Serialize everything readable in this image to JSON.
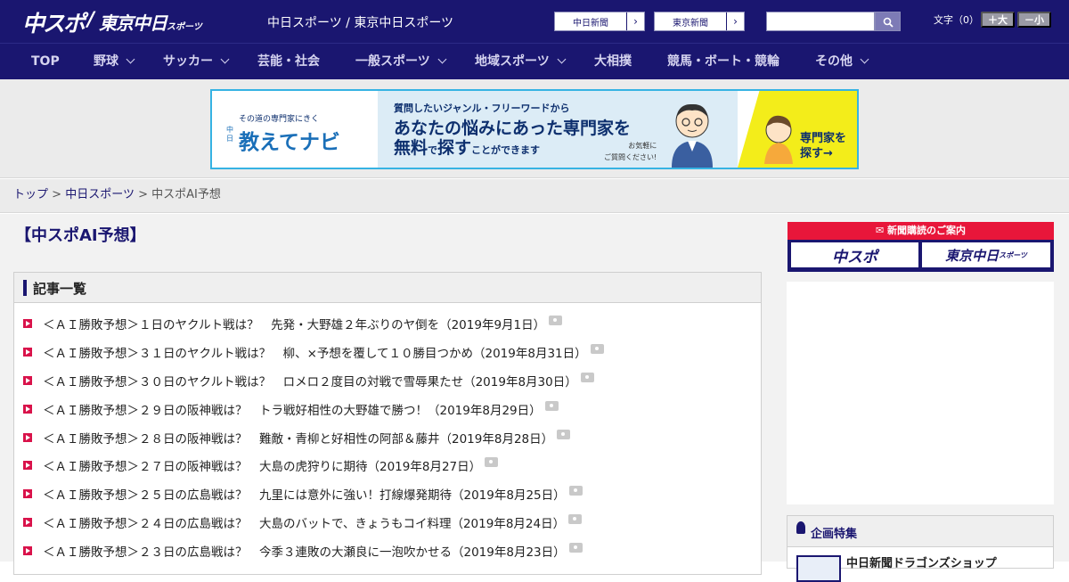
{
  "header": {
    "logo_chunichi_sports": "中スポ",
    "logo_separator": "/",
    "logo_tokyo": "東京中日",
    "logo_tokyo_small": "スポーツ",
    "site_title": "中日スポーツ / 東京中日スポーツ",
    "ext_links": [
      "中日新聞",
      "東京新聞"
    ],
    "search_placeholder": "",
    "font_size_label": "文字（0）",
    "font_larger": "＋大",
    "font_smaller": "－小"
  },
  "nav": {
    "items": [
      {
        "label": "TOP",
        "dropdown": false
      },
      {
        "label": "野球",
        "dropdown": true
      },
      {
        "label": "サッカー",
        "dropdown": true
      },
      {
        "label": "芸能・社会",
        "dropdown": false
      },
      {
        "label": "一般スポーツ",
        "dropdown": true
      },
      {
        "label": "地域スポーツ",
        "dropdown": true
      },
      {
        "label": "大相撲",
        "dropdown": false
      },
      {
        "label": "競馬・ボート・競輪",
        "dropdown": false
      },
      {
        "label": "その他",
        "dropdown": true
      }
    ]
  },
  "ad_banner": {
    "tagline": "その道の専門家にきく",
    "brand_prefix": "中日",
    "brand": "教えてナビ",
    "line1": "質問したいジャンル・フリーワードから",
    "line2": "あなたの悩みにあった専門家を",
    "line3_a": "無料",
    "line3_b": "で",
    "line3_c": "探す",
    "line3_d": "ことができます",
    "note_1": "お気軽に",
    "note_2": "ご質問ください!",
    "cta_1": "専門家を",
    "cta_2": "探す→"
  },
  "breadcrumb": {
    "items": [
      "トップ",
      "中日スポーツ",
      "中スポAI予想"
    ],
    "separator": ">"
  },
  "page": {
    "title": "【中スポAI予想】"
  },
  "article_list": {
    "heading": "記事一覧",
    "articles": [
      "＜ＡＩ勝敗予想＞１日のヤクルト戦は？　先発・大野雄２年ぶりのヤ倒を（2019年9月1日）",
      "＜ＡＩ勝敗予想＞３１日のヤクルト戦は？　柳、×予想を覆して１０勝目つかめ（2019年8月31日）",
      "＜ＡＩ勝敗予想＞３０日のヤクルト戦は？　ロメロ２度目の対戦で雪辱果たせ（2019年8月30日）",
      "＜ＡＩ勝敗予想＞２９日の阪神戦は？　トラ戦好相性の大野雄で勝つ！（2019年8月29日）",
      "＜ＡＩ勝敗予想＞２８日の阪神戦は？　難敵・青柳と好相性の阿部＆藤井（2019年8月28日）",
      "＜ＡＩ勝敗予想＞２７日の阪神戦は？　大島の虎狩りに期待（2019年8月27日）",
      "＜ＡＩ勝敗予想＞２５日の広島戦は？　九里には意外に強い！打線爆発期待（2019年8月25日）",
      "＜ＡＩ勝敗予想＞２４日の広島戦は？　大島のバットで、きょうもコイ料理（2019年8月24日）",
      "＜ＡＩ勝敗予想＞２３日の広島戦は？　今季３連敗の大瀬良に一泡吹かせる（2019年8月23日）"
    ]
  },
  "sidebar": {
    "subscription_heading": "新聞購読のご案内",
    "subscription_chunichi": "中スポ",
    "subscription_tokyo": "東京中日",
    "subscription_tokyo_small": "スポーツ",
    "feature_heading": "企画特集",
    "feature_item": "中日新聞ドラゴンズショップ"
  },
  "colors": {
    "brand_navy": "#1a1670",
    "accent_red": "#d9124a",
    "banner_blue": "#36b3e3"
  }
}
